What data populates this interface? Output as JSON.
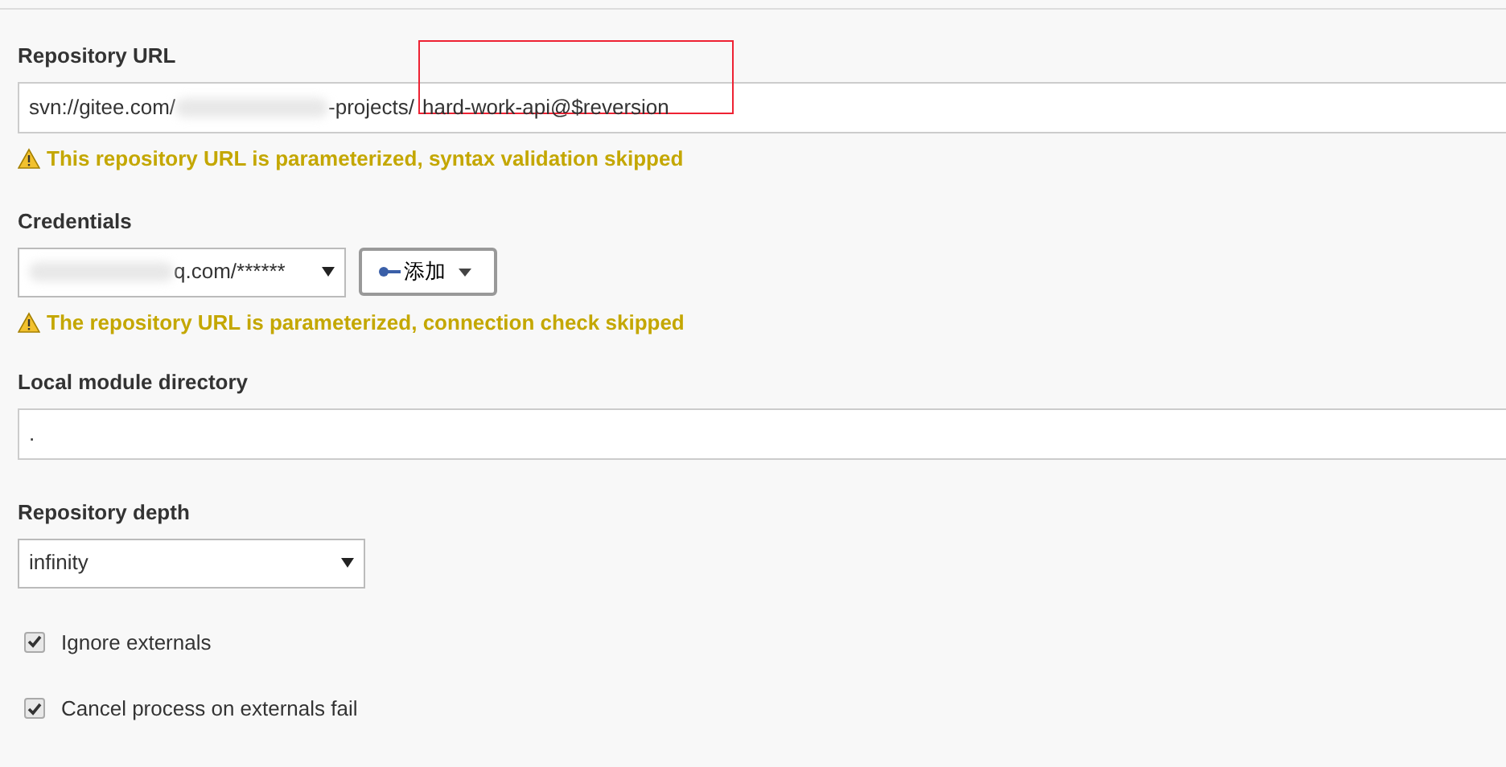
{
  "repository_url": {
    "label": "Repository URL",
    "value_start": "svn://gitee.com/",
    "value_middle": "-projects/",
    "value_end": "hard-work-api@$reversion",
    "warning": "This repository URL is parameterized, syntax validation skipped"
  },
  "credentials": {
    "label": "Credentials",
    "value": "q.com/******",
    "add_button": "添加",
    "warning": "The repository URL is parameterized, connection check skipped"
  },
  "local_module_directory": {
    "label": "Local module directory",
    "value": "."
  },
  "repository_depth": {
    "label": "Repository depth",
    "value": "infinity"
  },
  "options": [
    {
      "label": "Ignore externals",
      "checked": true
    },
    {
      "label": "Cancel process on externals fail",
      "checked": true
    }
  ]
}
